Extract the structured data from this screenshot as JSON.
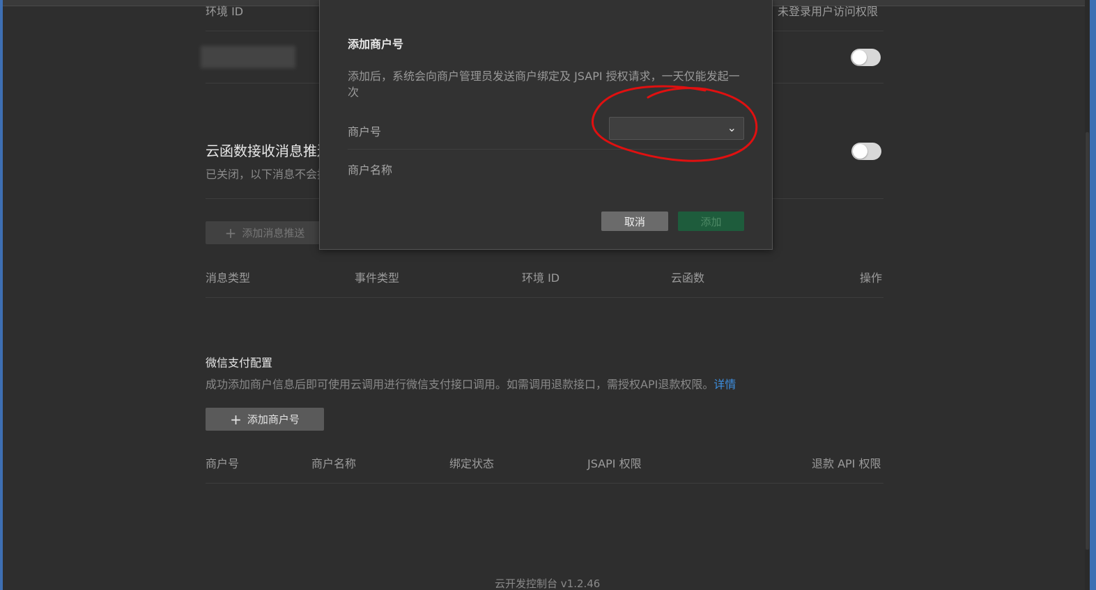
{
  "background_page": {
    "top_partial": {
      "env_id_label": "环境 ID",
      "unauth_access_label": "未登录用户访问权限"
    },
    "cloud_push": {
      "title": "云函数接收消息推送",
      "desc": "已关闭，以下消息不会推送到云函数",
      "add_button": "添加消息推送",
      "columns": [
        "消息类型",
        "事件类型",
        "环境 ID",
        "云函数",
        "操作"
      ]
    },
    "wxpay": {
      "title": "微信支付配置",
      "desc": "成功添加商户信息后即可使用云调用进行微信支付接口调用。如需调用退款接口，需授权API退款权限。",
      "detail_link": "详情",
      "add_button": "添加商户号",
      "columns": [
        "商户号",
        "商户名称",
        "绑定状态",
        "JSAPI 权限",
        "退款 API 权限"
      ]
    },
    "footer_version": "云开发控制台 v1.2.46"
  },
  "modal": {
    "title": "添加商户号",
    "desc": "添加后，系统会向商户管理员发送商户绑定及 JSAPI 授权请求，一天仅能发起一次",
    "merchant_id_label": "商户号",
    "merchant_id_value": "",
    "merchant_name_label": "商户名称",
    "cancel_label": "取消",
    "add_label": "添加"
  },
  "colors": {
    "background": "#2e2e2e",
    "modal_bg": "#323232",
    "add_button_green": "#1e5c3c",
    "link_blue": "#3d8fe0",
    "annotation_red": "#e01010"
  },
  "icons": [
    "plus-icon",
    "chevron-down-icon"
  ]
}
